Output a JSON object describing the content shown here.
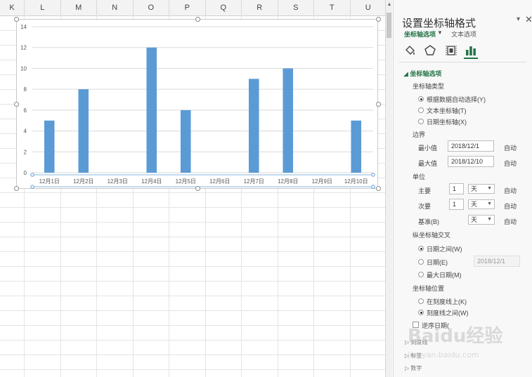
{
  "sheet": {
    "columns": [
      "K",
      "L",
      "M",
      "N",
      "O",
      "P",
      "Q",
      "R",
      "S",
      "T",
      "U"
    ]
  },
  "chart_data": {
    "type": "bar",
    "categories": [
      "12月1日",
      "12月2日",
      "12月3日",
      "12月4日",
      "12月5日",
      "12月6日",
      "12月7日",
      "12月8日",
      "12月9日",
      "12月10日"
    ],
    "values": [
      5,
      8,
      0,
      12,
      6,
      0,
      9,
      10,
      0,
      5
    ],
    "ylim": [
      0,
      14
    ],
    "yticks": [
      0,
      2,
      4,
      6,
      8,
      10,
      12,
      14
    ],
    "bar_color": "#5b9bd5",
    "grid": true,
    "title": "",
    "xlabel": "",
    "ylabel": ""
  },
  "panel": {
    "title": "设置坐标轴格式",
    "pin": "▾",
    "close": "✕",
    "tab_axis_options": "坐标轴选项",
    "tab_caret": "▼",
    "tab_text_options": "文本选项",
    "icons": [
      "fill-line-icon",
      "effects-icon",
      "size-properties-icon",
      "axis-options-icon"
    ],
    "section": "◢ 坐标轴选项",
    "axis_type": {
      "heading": "坐标轴类型",
      "options": [
        "根据数据自动选择(Y)",
        "文本坐标轴(T)",
        "日期坐标轴(X)"
      ],
      "selected": 0
    },
    "bounds": {
      "heading": "边界",
      "min_label": "最小值",
      "min_value": "2018/12/1",
      "max_label": "最大值",
      "max_value": "2018/12/10",
      "auto": "自动"
    },
    "units": {
      "heading": "单位",
      "major_label": "主要",
      "major_value": "1",
      "major_unit": "天",
      "minor_label": "次要",
      "minor_value": "1",
      "minor_unit": "天",
      "base_label": "基准(B)",
      "base_unit": "天",
      "auto": "自动"
    },
    "crosses": {
      "heading": "纵坐标轴交叉",
      "options": [
        "日期之间(W)",
        "日期(E)",
        "最大日期(M)"
      ],
      "selected": 0,
      "date_value": "2018/12/1"
    },
    "position": {
      "heading": "坐标轴位置",
      "options": [
        "在刻度线上(K)",
        "刻度线之间(W)"
      ],
      "selected": 1
    },
    "reverse": "逆序日期(",
    "collapsed": [
      "▷ 刻度线",
      "▷ 标签",
      "▷ 数字"
    ]
  },
  "watermark": {
    "text": "Baidu经验",
    "sub": "jingyan.baidu.com"
  }
}
